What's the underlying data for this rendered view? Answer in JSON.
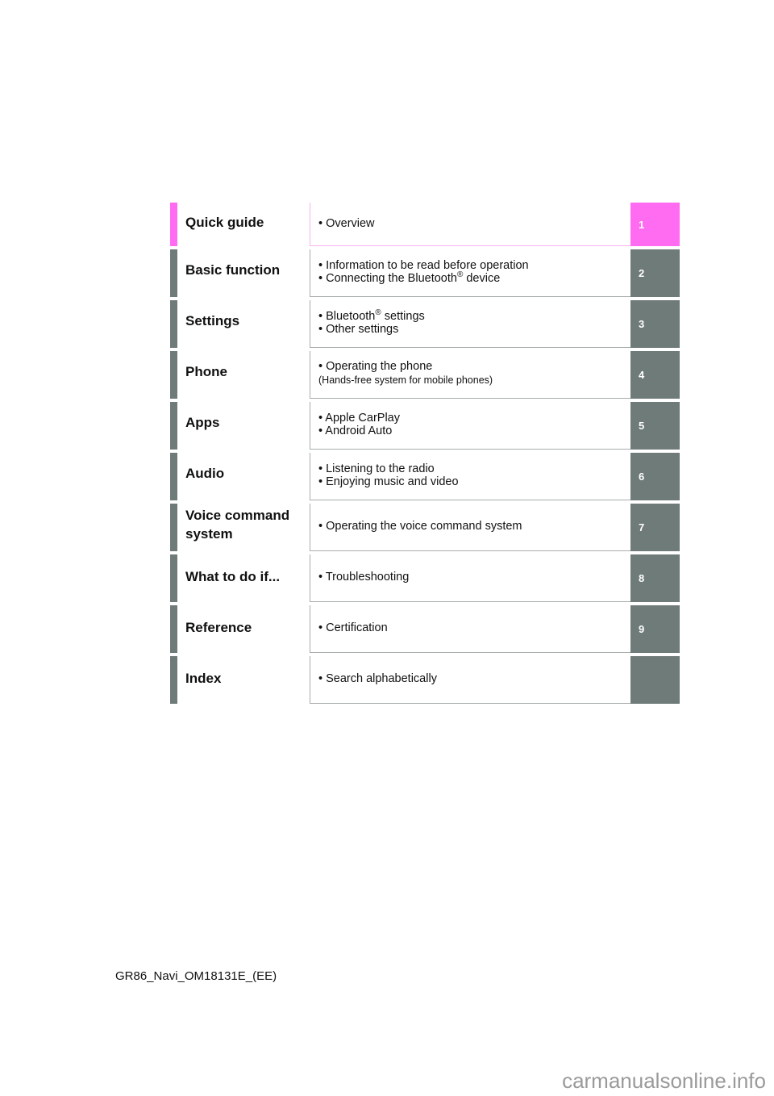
{
  "toc": {
    "rows": [
      {
        "title": "Quick guide",
        "lines": [
          "• Overview"
        ],
        "tab": "1",
        "color": "#ff6cf2"
      },
      {
        "title": "Basic function",
        "lines": [
          "• Information to be read before operation",
          "• Connecting the Bluetooth® device"
        ],
        "tab": "2",
        "color": "#6e7b79"
      },
      {
        "title": "Settings",
        "lines": [
          "• Bluetooth® settings",
          "• Other settings"
        ],
        "tab": "3",
        "color": "#6e7b79"
      },
      {
        "title": "Phone",
        "lines": [
          "• Operating the phone",
          "(Hands-free system for mobile phones)"
        ],
        "tab": "4",
        "color": "#6e7b79"
      },
      {
        "title": "Apps",
        "lines": [
          "• Apple CarPlay",
          "• Android Auto"
        ],
        "tab": "5",
        "color": "#6e7b79"
      },
      {
        "title": "Audio",
        "lines": [
          "• Listening to the radio",
          "• Enjoying music and video"
        ],
        "tab": "6",
        "color": "#6e7b79"
      },
      {
        "title": "Voice command system",
        "lines": [
          "• Operating the voice command system"
        ],
        "tab": "7",
        "color": "#6e7b79"
      },
      {
        "title": "What to do if...",
        "lines": [
          "• Troubleshooting"
        ],
        "tab": "8",
        "color": "#6e7b79"
      },
      {
        "title": "Reference",
        "lines": [
          "• Certification"
        ],
        "tab": "9",
        "color": "#6e7b79"
      },
      {
        "title": "Index",
        "lines": [
          "• Search alphabetically"
        ],
        "tab": "",
        "color": "#6e7b79"
      }
    ]
  },
  "footer": {
    "document_code": "GR86_Navi_OM18131E_(EE)"
  },
  "watermark": {
    "text": "carmanualsonline.info"
  }
}
